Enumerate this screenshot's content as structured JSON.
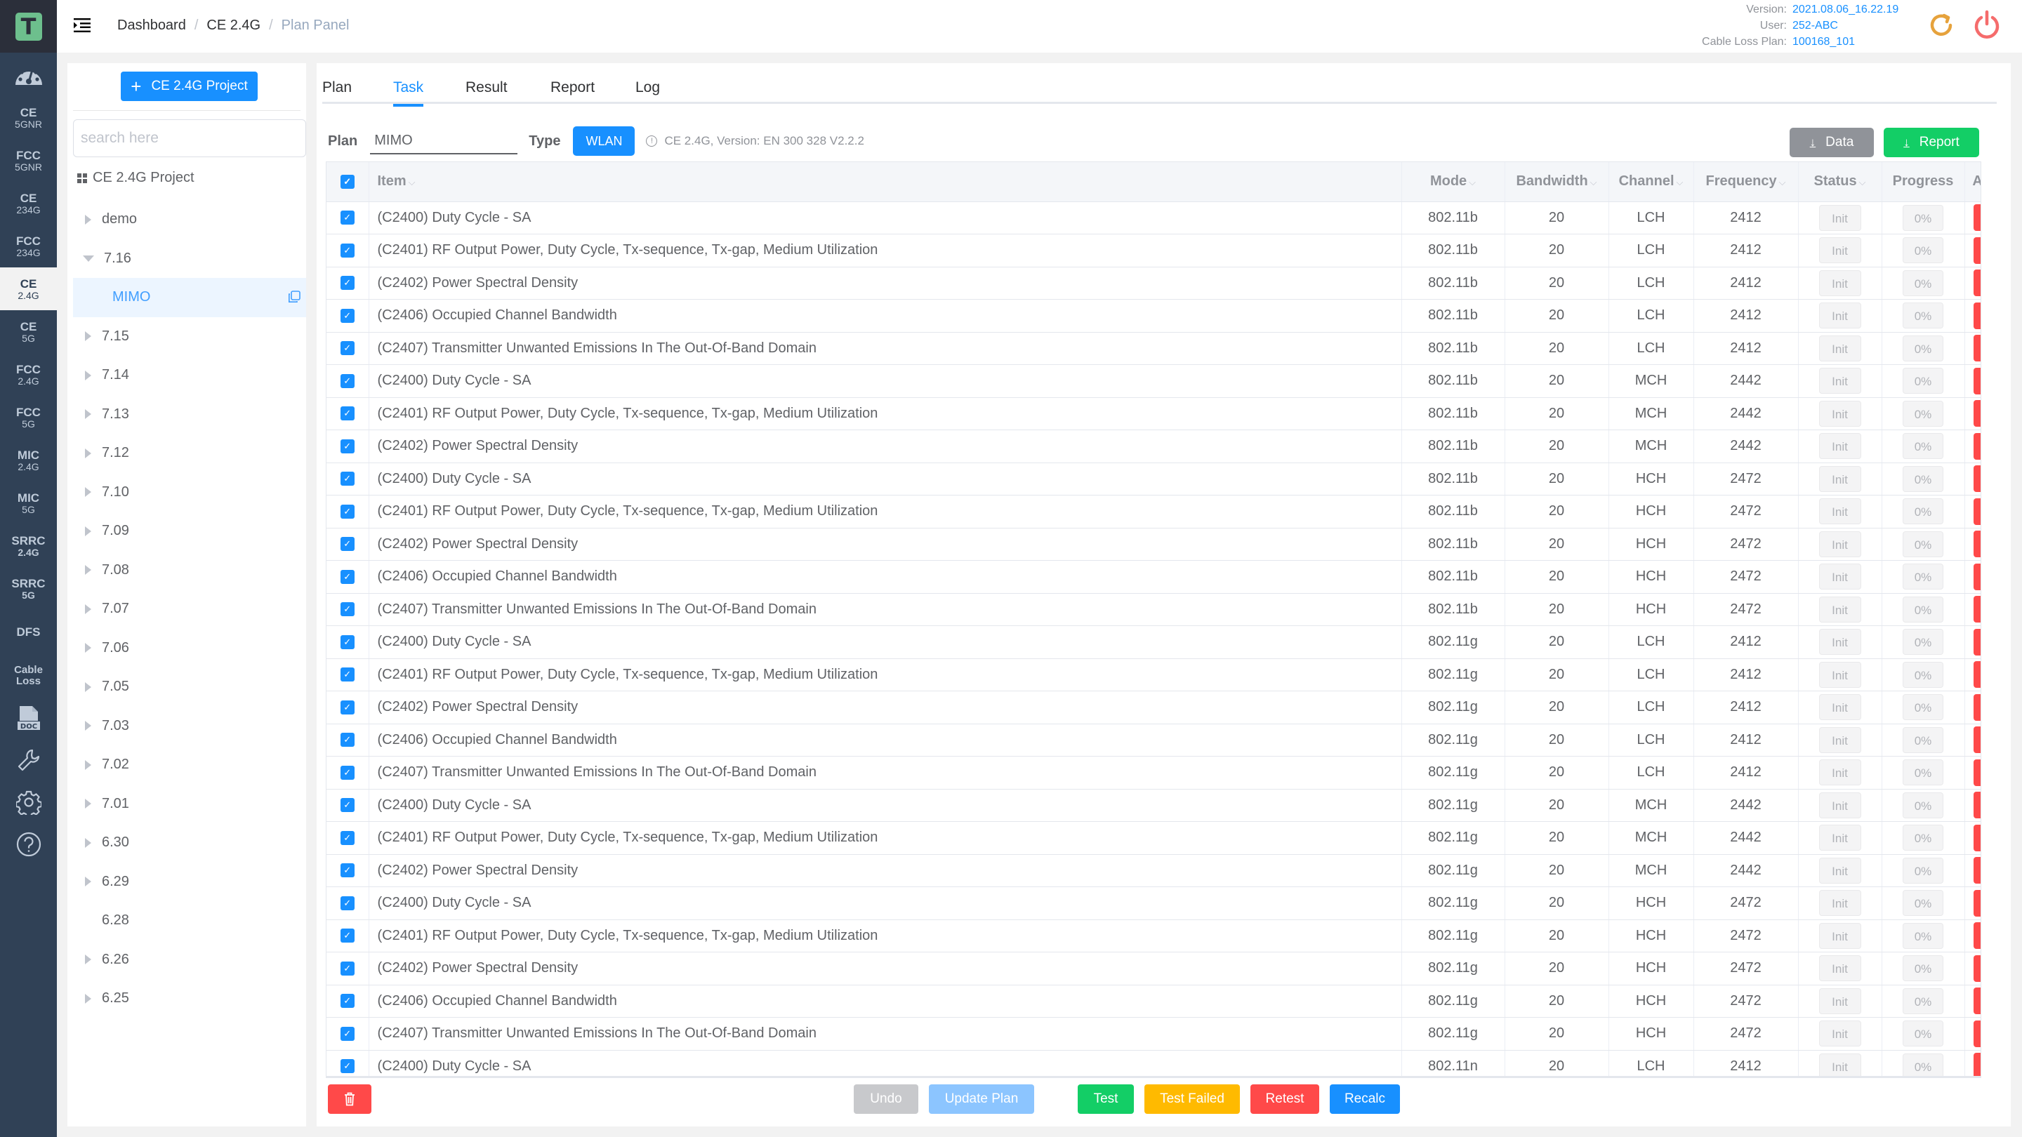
{
  "app": {
    "logo_letter": "T",
    "brand_color": "#6dbf8d"
  },
  "rail": {
    "items": [
      {
        "l1": "CE",
        "l2": "5GNR"
      },
      {
        "l1": "FCC",
        "l2": "5GNR"
      },
      {
        "l1": "CE",
        "l2": "234G"
      },
      {
        "l1": "FCC",
        "l2": "234G"
      },
      {
        "l1": "CE",
        "l2": "2.4G",
        "active": true
      },
      {
        "l1": "CE",
        "l2": "5G"
      },
      {
        "l1": "FCC",
        "l2": "2.4G"
      },
      {
        "l1": "FCC",
        "l2": "5G"
      },
      {
        "l1": "MIC",
        "l2": "2.4G"
      },
      {
        "l1": "MIC",
        "l2": "5G"
      },
      {
        "l1": "SRRC",
        "l2": "2.4G"
      },
      {
        "l1": "SRRC",
        "l2": "5G"
      },
      {
        "l1": "DFS",
        "l2": ""
      },
      {
        "l1": "Cable",
        "l2": "Loss"
      }
    ],
    "icons": [
      "dashboard-gauge-icon",
      "doc-icon",
      "wrench-icon",
      "gear-icon",
      "help-icon"
    ],
    "doc_icon_label": "DOC"
  },
  "header": {
    "breadcrumb": [
      "Dashboard",
      "CE 2.4G",
      "Plan Panel"
    ],
    "separator": "/",
    "info": [
      {
        "key": "Version:",
        "value": "2021.08.06_16.22.19"
      },
      {
        "key": "User:",
        "value": "252-ABC"
      },
      {
        "key": "Cable Loss Plan:",
        "value": "100168_101"
      }
    ],
    "refresh_color": "#e6a23c",
    "power_color": "#f56c6c"
  },
  "tree": {
    "new_project_label": "CE 2.4G Project",
    "search_placeholder": "search here",
    "root_label": "CE 2.4G Project",
    "nodes": [
      {
        "label": "demo",
        "state": "closed"
      },
      {
        "label": "7.16",
        "state": "open",
        "children": [
          {
            "label": "MIMO",
            "selected": true
          }
        ]
      },
      {
        "label": "7.15",
        "state": "closed"
      },
      {
        "label": "7.14",
        "state": "closed"
      },
      {
        "label": "7.13",
        "state": "closed"
      },
      {
        "label": "7.12",
        "state": "closed"
      },
      {
        "label": "7.10",
        "state": "closed"
      },
      {
        "label": "7.09",
        "state": "closed"
      },
      {
        "label": "7.08",
        "state": "closed"
      },
      {
        "label": "7.07",
        "state": "closed"
      },
      {
        "label": "7.06",
        "state": "closed"
      },
      {
        "label": "7.05",
        "state": "closed"
      },
      {
        "label": "7.03",
        "state": "closed"
      },
      {
        "label": "7.02",
        "state": "closed"
      },
      {
        "label": "7.01",
        "state": "closed"
      },
      {
        "label": "6.30",
        "state": "closed"
      },
      {
        "label": "6.29",
        "state": "closed"
      },
      {
        "label": "6.28",
        "state": "leaf"
      },
      {
        "label": "6.26",
        "state": "closed"
      },
      {
        "label": "6.25",
        "state": "closed"
      }
    ]
  },
  "tabs": [
    "Plan",
    "Task",
    "Result",
    "Report",
    "Log"
  ],
  "active_tab": "Task",
  "plan_bar": {
    "plan_label": "Plan",
    "plan_value": "MIMO",
    "type_label": "Type",
    "type_value": "WLAN",
    "hint_icon": "!",
    "hint": "CE 2.4G, Version: EN 300 328 V2.2.2",
    "data_button": "Data",
    "report_button": "Report",
    "download_glyph": "↓"
  },
  "table": {
    "columns": [
      "Item",
      "Mode",
      "Bandwidth",
      "Channel",
      "Frequency",
      "Status",
      "Progress",
      "Action"
    ],
    "sortable": [
      true,
      true,
      true,
      true,
      true,
      true,
      false,
      false
    ],
    "all_checked": true,
    "rows": [
      {
        "item": "(C2400) Duty Cycle - SA",
        "mode": "802.11b",
        "bw": "20",
        "ch": "LCH",
        "freq": "2412",
        "status": "Init",
        "progress": "0%"
      },
      {
        "item": "(C2401) RF Output Power, Duty Cycle, Tx-sequence, Tx-gap, Medium Utilization",
        "mode": "802.11b",
        "bw": "20",
        "ch": "LCH",
        "freq": "2412",
        "status": "Init",
        "progress": "0%"
      },
      {
        "item": "(C2402) Power Spectral Density",
        "mode": "802.11b",
        "bw": "20",
        "ch": "LCH",
        "freq": "2412",
        "status": "Init",
        "progress": "0%"
      },
      {
        "item": "(C2406) Occupied Channel Bandwidth",
        "mode": "802.11b",
        "bw": "20",
        "ch": "LCH",
        "freq": "2412",
        "status": "Init",
        "progress": "0%"
      },
      {
        "item": "(C2407) Transmitter Unwanted Emissions In The Out-Of-Band Domain",
        "mode": "802.11b",
        "bw": "20",
        "ch": "LCH",
        "freq": "2412",
        "status": "Init",
        "progress": "0%"
      },
      {
        "item": "(C2400) Duty Cycle - SA",
        "mode": "802.11b",
        "bw": "20",
        "ch": "MCH",
        "freq": "2442",
        "status": "Init",
        "progress": "0%"
      },
      {
        "item": "(C2401) RF Output Power, Duty Cycle, Tx-sequence, Tx-gap, Medium Utilization",
        "mode": "802.11b",
        "bw": "20",
        "ch": "MCH",
        "freq": "2442",
        "status": "Init",
        "progress": "0%"
      },
      {
        "item": "(C2402) Power Spectral Density",
        "mode": "802.11b",
        "bw": "20",
        "ch": "MCH",
        "freq": "2442",
        "status": "Init",
        "progress": "0%"
      },
      {
        "item": "(C2400) Duty Cycle - SA",
        "mode": "802.11b",
        "bw": "20",
        "ch": "HCH",
        "freq": "2472",
        "status": "Init",
        "progress": "0%"
      },
      {
        "item": "(C2401) RF Output Power, Duty Cycle, Tx-sequence, Tx-gap, Medium Utilization",
        "mode": "802.11b",
        "bw": "20",
        "ch": "HCH",
        "freq": "2472",
        "status": "Init",
        "progress": "0%"
      },
      {
        "item": "(C2402) Power Spectral Density",
        "mode": "802.11b",
        "bw": "20",
        "ch": "HCH",
        "freq": "2472",
        "status": "Init",
        "progress": "0%"
      },
      {
        "item": "(C2406) Occupied Channel Bandwidth",
        "mode": "802.11b",
        "bw": "20",
        "ch": "HCH",
        "freq": "2472",
        "status": "Init",
        "progress": "0%"
      },
      {
        "item": "(C2407) Transmitter Unwanted Emissions In The Out-Of-Band Domain",
        "mode": "802.11b",
        "bw": "20",
        "ch": "HCH",
        "freq": "2472",
        "status": "Init",
        "progress": "0%"
      },
      {
        "item": "(C2400) Duty Cycle - SA",
        "mode": "802.11g",
        "bw": "20",
        "ch": "LCH",
        "freq": "2412",
        "status": "Init",
        "progress": "0%"
      },
      {
        "item": "(C2401) RF Output Power, Duty Cycle, Tx-sequence, Tx-gap, Medium Utilization",
        "mode": "802.11g",
        "bw": "20",
        "ch": "LCH",
        "freq": "2412",
        "status": "Init",
        "progress": "0%"
      },
      {
        "item": "(C2402) Power Spectral Density",
        "mode": "802.11g",
        "bw": "20",
        "ch": "LCH",
        "freq": "2412",
        "status": "Init",
        "progress": "0%"
      },
      {
        "item": "(C2406) Occupied Channel Bandwidth",
        "mode": "802.11g",
        "bw": "20",
        "ch": "LCH",
        "freq": "2412",
        "status": "Init",
        "progress": "0%"
      },
      {
        "item": "(C2407) Transmitter Unwanted Emissions In The Out-Of-Band Domain",
        "mode": "802.11g",
        "bw": "20",
        "ch": "LCH",
        "freq": "2412",
        "status": "Init",
        "progress": "0%"
      },
      {
        "item": "(C2400) Duty Cycle - SA",
        "mode": "802.11g",
        "bw": "20",
        "ch": "MCH",
        "freq": "2442",
        "status": "Init",
        "progress": "0%"
      },
      {
        "item": "(C2401) RF Output Power, Duty Cycle, Tx-sequence, Tx-gap, Medium Utilization",
        "mode": "802.11g",
        "bw": "20",
        "ch": "MCH",
        "freq": "2442",
        "status": "Init",
        "progress": "0%"
      },
      {
        "item": "(C2402) Power Spectral Density",
        "mode": "802.11g",
        "bw": "20",
        "ch": "MCH",
        "freq": "2442",
        "status": "Init",
        "progress": "0%"
      },
      {
        "item": "(C2400) Duty Cycle - SA",
        "mode": "802.11g",
        "bw": "20",
        "ch": "HCH",
        "freq": "2472",
        "status": "Init",
        "progress": "0%"
      },
      {
        "item": "(C2401) RF Output Power, Duty Cycle, Tx-sequence, Tx-gap, Medium Utilization",
        "mode": "802.11g",
        "bw": "20",
        "ch": "HCH",
        "freq": "2472",
        "status": "Init",
        "progress": "0%"
      },
      {
        "item": "(C2402) Power Spectral Density",
        "mode": "802.11g",
        "bw": "20",
        "ch": "HCH",
        "freq": "2472",
        "status": "Init",
        "progress": "0%"
      },
      {
        "item": "(C2406) Occupied Channel Bandwidth",
        "mode": "802.11g",
        "bw": "20",
        "ch": "HCH",
        "freq": "2472",
        "status": "Init",
        "progress": "0%"
      },
      {
        "item": "(C2407) Transmitter Unwanted Emissions In The Out-Of-Band Domain",
        "mode": "802.11g",
        "bw": "20",
        "ch": "HCH",
        "freq": "2472",
        "status": "Init",
        "progress": "0%"
      },
      {
        "item": "(C2400) Duty Cycle - SA",
        "mode": "802.11n",
        "bw": "20",
        "ch": "LCH",
        "freq": "2412",
        "status": "Init",
        "progress": "0%"
      }
    ]
  },
  "footer": {
    "undo": "Undo",
    "update_plan": "Update Plan",
    "test": "Test",
    "test_failed": "Test Failed",
    "retest": "Retest",
    "recalc": "Recalc"
  },
  "colors": {
    "primary": "#1890ff",
    "success": "#13ce66",
    "warning": "#ffba00",
    "danger": "#ff4949",
    "info": "#909399",
    "rail_bg": "#304156"
  }
}
